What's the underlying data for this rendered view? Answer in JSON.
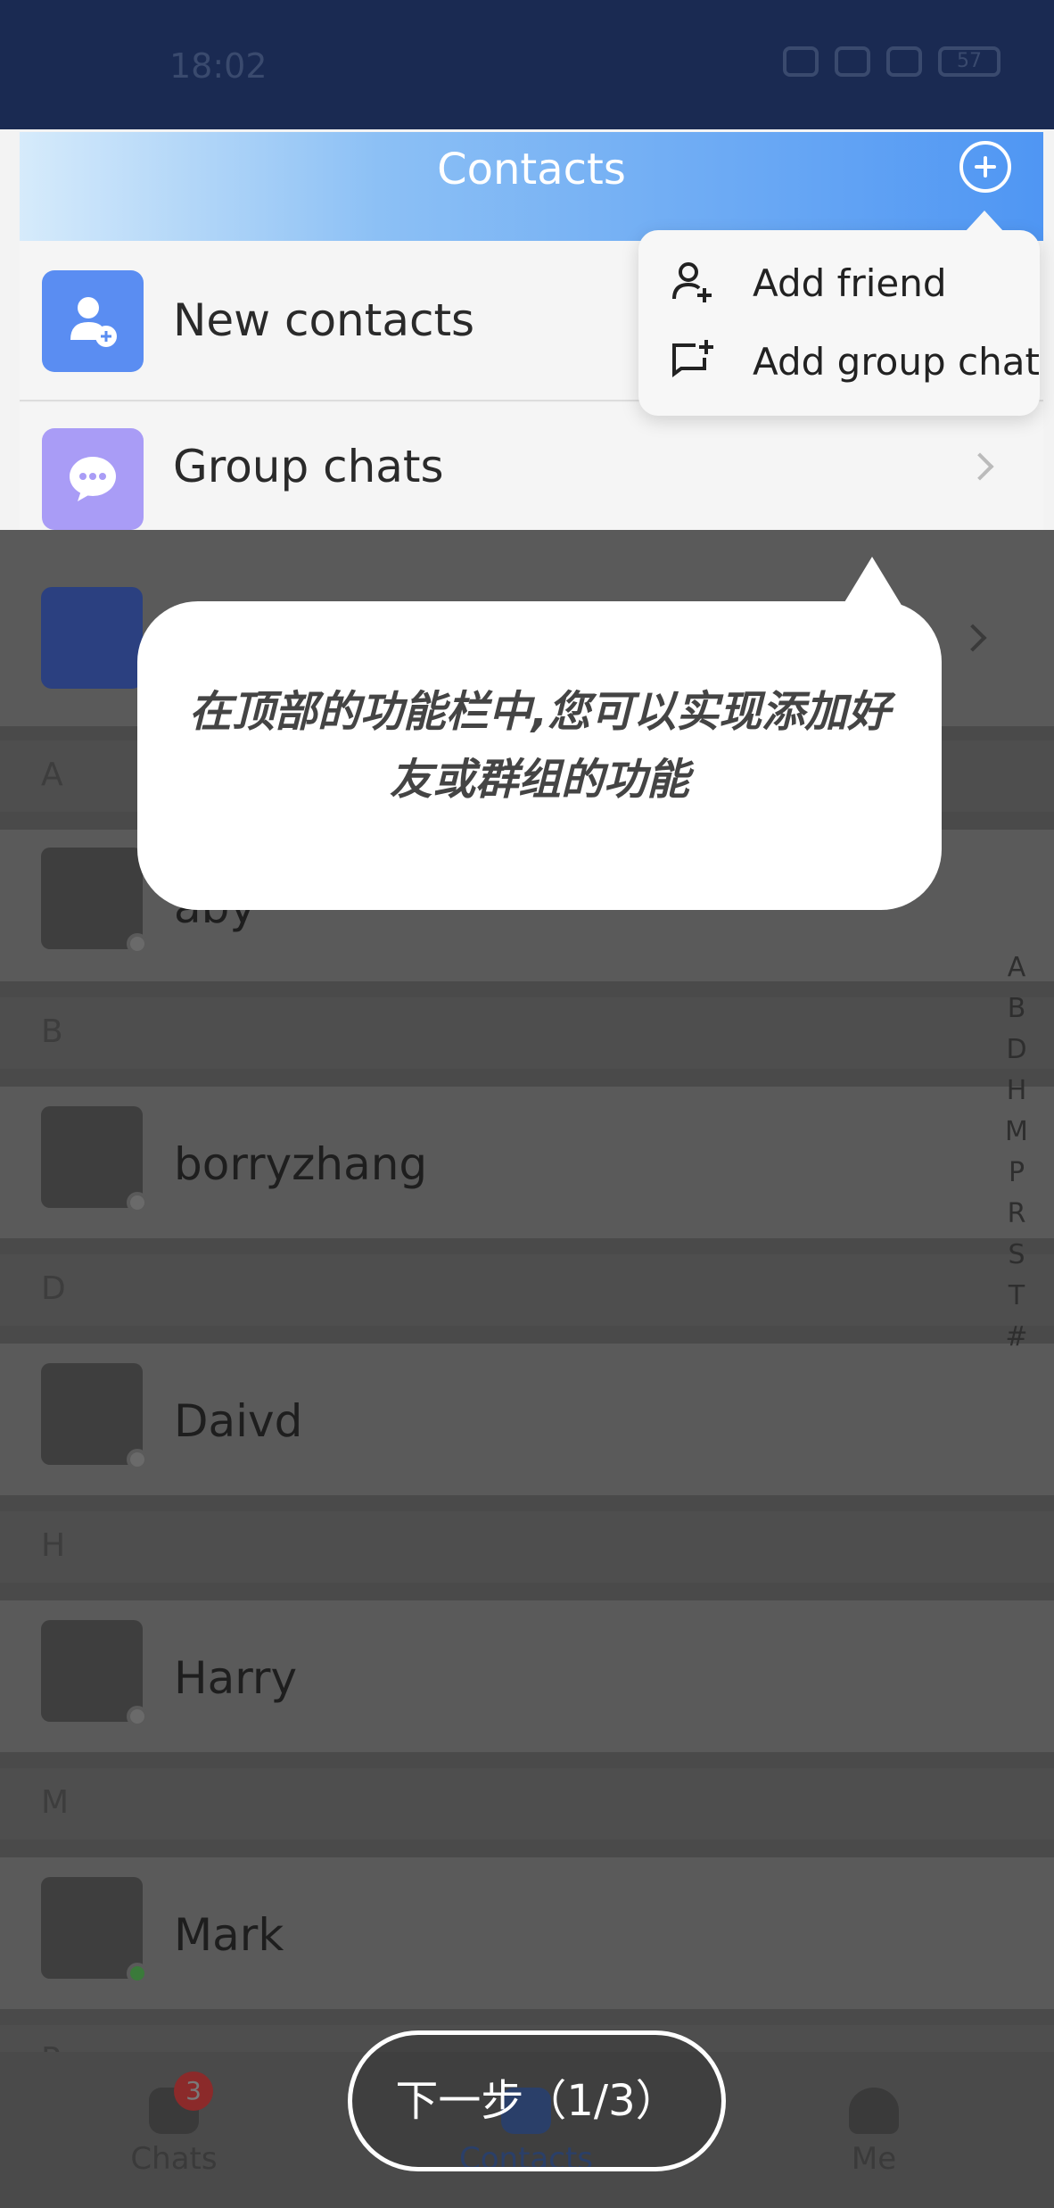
{
  "status_bar": {
    "time": "18:02",
    "battery": "57"
  },
  "header": {
    "title": "Contacts"
  },
  "rows": {
    "new_contacts": "New contacts",
    "group_chats": "Group chats"
  },
  "popup_menu": {
    "add_friend": "Add friend",
    "add_group_chat": "Add group chat"
  },
  "guide": {
    "text": "在顶部的功能栏中,您可以实现添加好友或群组的功能",
    "next_button": "下一步（1/3）"
  },
  "contacts": [
    {
      "section": "A",
      "name": "aby",
      "online": false
    },
    {
      "section": "B",
      "name": "borryzhang",
      "online": false
    },
    {
      "section": "D",
      "name": "Daivd",
      "online": false
    },
    {
      "section": "H",
      "name": "Harry",
      "online": false
    },
    {
      "section": "M",
      "name": "Mark",
      "online": true
    }
  ],
  "next_section": "P",
  "index_letters": [
    "A",
    "B",
    "D",
    "H",
    "M",
    "P",
    "R",
    "S",
    "T",
    "#"
  ],
  "tabbar": {
    "chats": "Chats",
    "chats_badge": "3",
    "contacts": "Contacts",
    "me": "Me"
  },
  "colors": {
    "header_start": "#d6ebfb",
    "header_end": "#4f96f3",
    "accent": "#5a8df2"
  }
}
